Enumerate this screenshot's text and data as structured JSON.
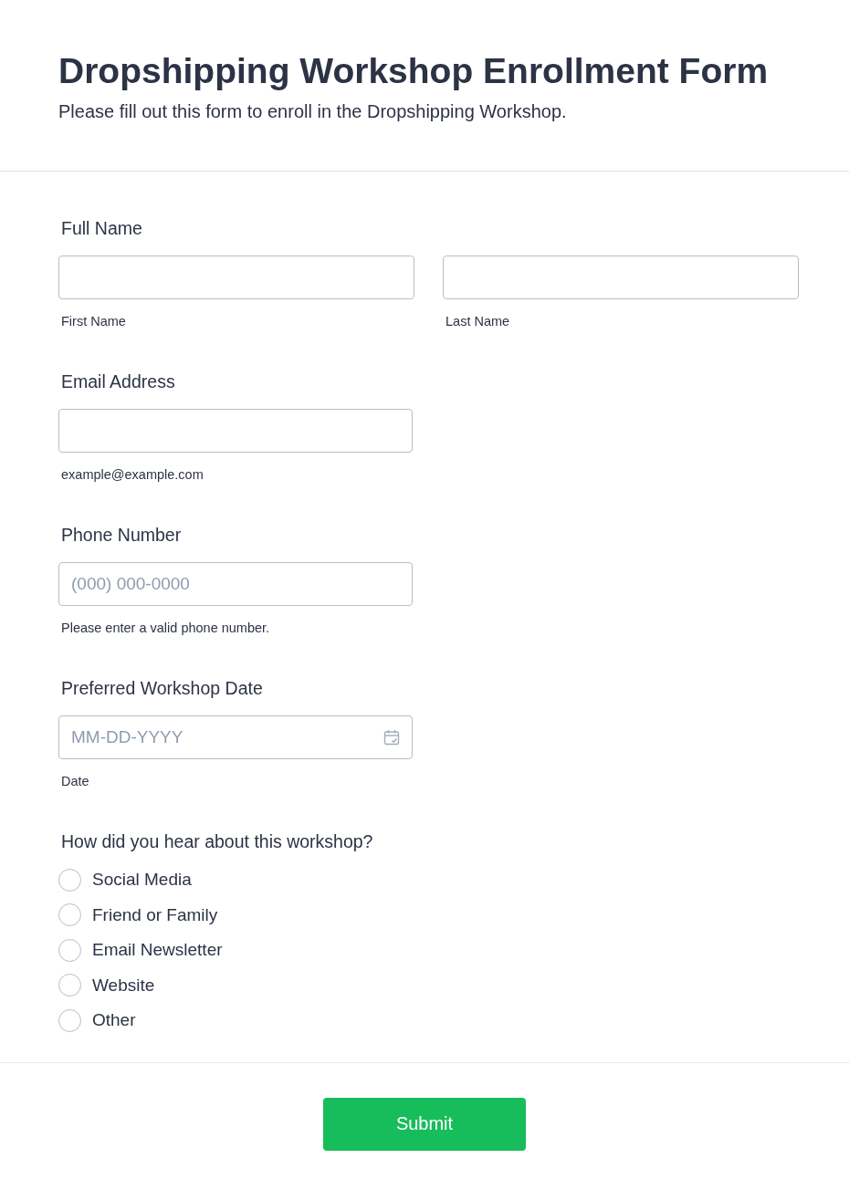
{
  "header": {
    "title": "Dropshipping Workshop Enrollment Form",
    "subtitle": "Please fill out this form to enroll in the Dropshipping Workshop."
  },
  "fields": [
    {
      "kind": "split",
      "label": "Full Name",
      "inputs": [
        {
          "sublabel": "First Name"
        },
        {
          "sublabel": "Last Name"
        }
      ]
    },
    {
      "kind": "text",
      "label": "Email Address",
      "sublabel": "example@example.com"
    },
    {
      "kind": "text",
      "label": "Phone Number",
      "placeholder": "(000) 000-0000",
      "sublabel": "Please enter a valid phone number."
    },
    {
      "kind": "date",
      "label": "Preferred Workshop Date",
      "placeholder": "MM-DD-YYYY",
      "sublabel": "Date"
    },
    {
      "kind": "radio",
      "label": "How did you hear about this workshop?",
      "options": [
        {
          "label": "Social Media",
          "selected": false
        },
        {
          "label": "Friend or Family",
          "selected": false
        },
        {
          "label": "Email Newsletter",
          "selected": false
        },
        {
          "label": "Website",
          "selected": false
        },
        {
          "label": "Other",
          "selected": false
        }
      ]
    }
  ],
  "submit_button": {
    "label": "Submit"
  }
}
